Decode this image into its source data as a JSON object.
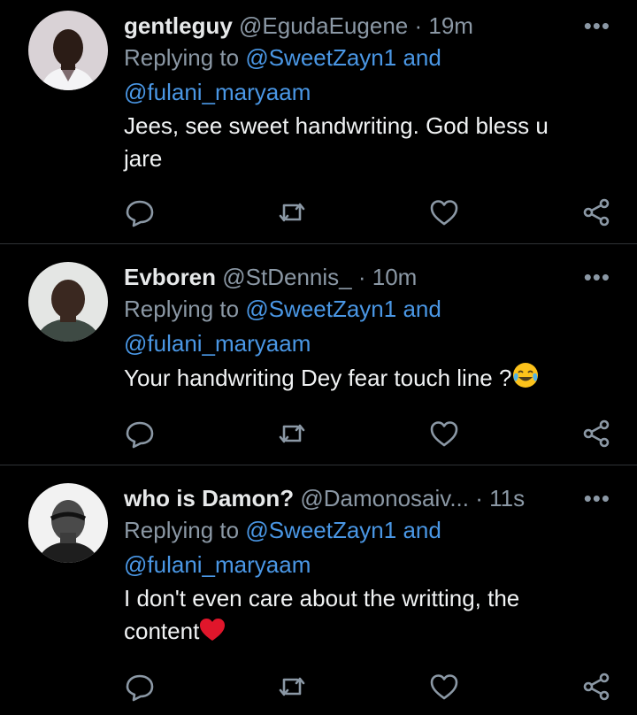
{
  "replies": [
    {
      "name": "gentleguy",
      "handle": "@EgudaEugene",
      "separator": "·",
      "time": "19m",
      "more": "•••",
      "replying_prefix": "Replying to",
      "mention1": "@SweetZayn1",
      "and": "and",
      "mention2": "@fulani_maryaam",
      "text_line1": "Jees, see sweet handwriting. God bless u",
      "text_line2": "jare"
    },
    {
      "name": "Evboren",
      "handle": "@StDennis_",
      "separator": "·",
      "time": "10m",
      "more": "•••",
      "replying_prefix": "Replying to",
      "mention1": "@SweetZayn1",
      "and": "and",
      "mention2": "@fulani_maryaam",
      "text_line1": "Your handwriting Dey fear touch line ?",
      "emoji": "face-with-tears-of-joy"
    },
    {
      "name": "who is Damon?",
      "handle": "@Damonosaiv...",
      "separator": "·",
      "time": "11s",
      "more": "•••",
      "replying_prefix": "Replying to",
      "mention1": "@SweetZayn1",
      "and": "and",
      "mention2": "@fulani_maryaam",
      "text_line1": "I don't even care about the writting, the",
      "text_line2": "content",
      "emoji": "red-heart"
    }
  ],
  "colors": {
    "background": "#000000",
    "text": "#e7e9ea",
    "muted": "#8b98a5",
    "link": "#4a97e5",
    "divider": "#2f3336"
  }
}
